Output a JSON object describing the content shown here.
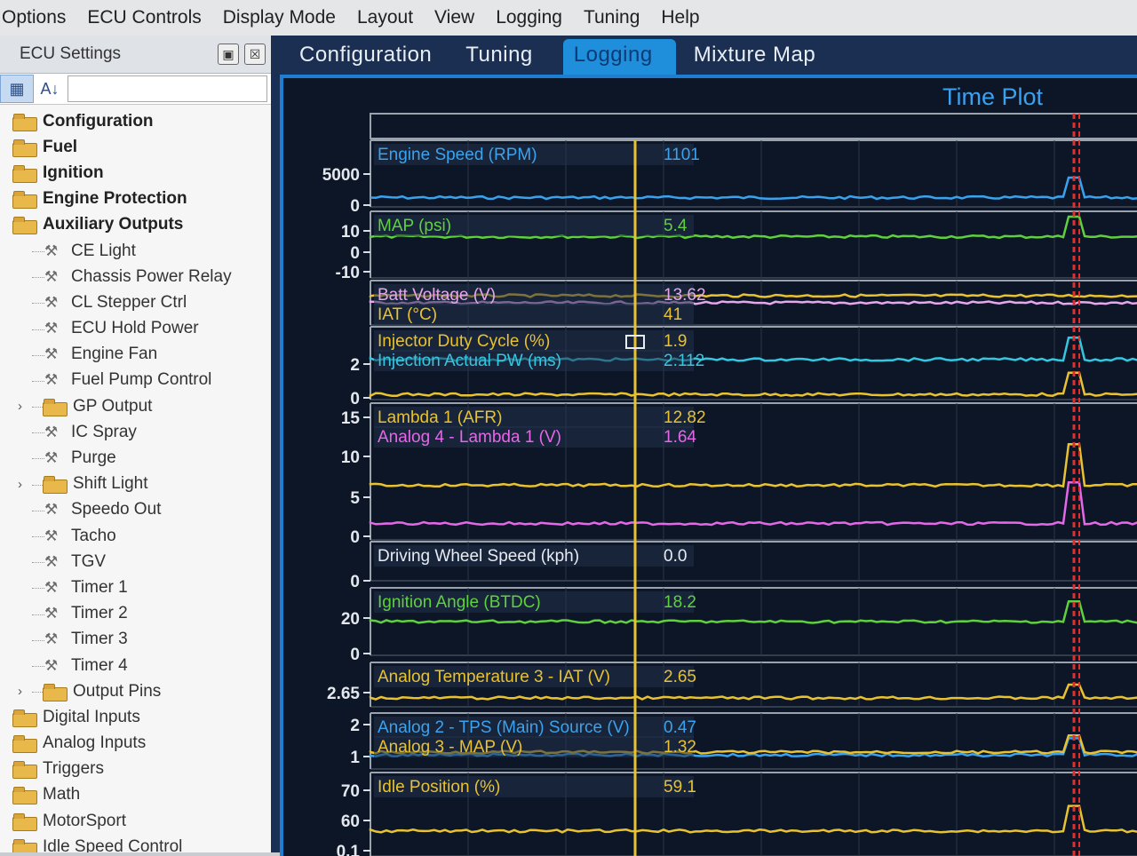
{
  "menu": [
    "Options",
    "ECU Controls",
    "Display Mode",
    "Layout",
    "View",
    "Logging",
    "Tuning",
    "Help"
  ],
  "sidebar": {
    "title": "ECU Settings",
    "pin_icon": "pin-icon",
    "close_icon": "close-icon",
    "items": [
      {
        "label": "Configuration",
        "type": "folder",
        "level": 0,
        "bold": true
      },
      {
        "label": "Fuel",
        "type": "folder",
        "level": 0,
        "bold": true
      },
      {
        "label": "Ignition",
        "type": "folder",
        "level": 0,
        "bold": true
      },
      {
        "label": "Engine Protection",
        "type": "folder",
        "level": 0,
        "bold": true
      },
      {
        "label": "Auxiliary Outputs",
        "type": "folder",
        "level": 0,
        "bold": true
      },
      {
        "label": "CE Light",
        "type": "setting",
        "level": 1
      },
      {
        "label": "Chassis Power Relay",
        "type": "setting",
        "level": 1
      },
      {
        "label": "CL Stepper Ctrl",
        "type": "setting",
        "level": 1
      },
      {
        "label": "ECU Hold Power",
        "type": "setting",
        "level": 1
      },
      {
        "label": "Engine Fan",
        "type": "setting",
        "level": 1
      },
      {
        "label": "Fuel Pump Control",
        "type": "setting",
        "level": 1
      },
      {
        "label": "GP Output",
        "type": "folder",
        "level": 1,
        "expander": true
      },
      {
        "label": "IC Spray",
        "type": "setting",
        "level": 1
      },
      {
        "label": "Purge",
        "type": "setting",
        "level": 1
      },
      {
        "label": "Shift Light",
        "type": "folder",
        "level": 1,
        "expander": true
      },
      {
        "label": "Speedo Out",
        "type": "setting",
        "level": 1
      },
      {
        "label": "Tacho",
        "type": "setting",
        "level": 1
      },
      {
        "label": "TGV",
        "type": "setting",
        "level": 1
      },
      {
        "label": "Timer 1",
        "type": "setting",
        "level": 1
      },
      {
        "label": "Timer 2",
        "type": "setting",
        "level": 1
      },
      {
        "label": "Timer 3",
        "type": "setting",
        "level": 1
      },
      {
        "label": "Timer 4",
        "type": "setting",
        "level": 1
      },
      {
        "label": "Output Pins",
        "type": "folder",
        "level": 1,
        "expander": true
      },
      {
        "label": "Digital Inputs",
        "type": "folder",
        "level": 0
      },
      {
        "label": "Analog Inputs",
        "type": "folder",
        "level": 0
      },
      {
        "label": "Triggers",
        "type": "folder",
        "level": 0
      },
      {
        "label": "Math",
        "type": "folder",
        "level": 0
      },
      {
        "label": "MotorSport",
        "type": "folder",
        "level": 0
      },
      {
        "label": "Idle Speed Control",
        "type": "folder",
        "level": 0
      }
    ]
  },
  "tabs": [
    {
      "label": "Configuration",
      "active": false
    },
    {
      "label": "Tuning",
      "active": false
    },
    {
      "label": "Logging",
      "active": true
    },
    {
      "label": "Mixture Map",
      "active": false
    }
  ],
  "plot": {
    "title": "Time Plot",
    "colors": {
      "background": "#0d1627",
      "cursor": "#e8c230",
      "marker": "#e0302e",
      "frame": "#9aa3ad"
    },
    "channels": [
      {
        "name": "Engine Speed (RPM)",
        "value": "1101",
        "color": "#3aa3ee",
        "ticks": [
          "5000",
          "0"
        ]
      },
      {
        "name": "MAP (psi)",
        "value": "5.4",
        "color": "#5fd13e",
        "ticks": [
          "10",
          "0",
          "-10"
        ]
      },
      {
        "name": "Batt Voltage (V)",
        "value": "13.62",
        "color": "#e6a7ec",
        "ticks": []
      },
      {
        "name": "IAT (°C)",
        "value": "41",
        "color": "#e8c230",
        "ticks": []
      },
      {
        "name": "Injector Duty Cycle (%)",
        "value": "1.9",
        "color": "#e8c230",
        "ticks": [
          "2",
          "0"
        ]
      },
      {
        "name": "Injection Actual PW (ms)",
        "value": "2.112",
        "color": "#35c7e0",
        "ticks": []
      },
      {
        "name": "Lambda 1 (AFR)",
        "value": "12.82",
        "color": "#e8c230",
        "ticks": [
          "15",
          "10",
          "5",
          "0"
        ]
      },
      {
        "name": "Analog 4 - Lambda 1 (V)",
        "value": "1.64",
        "color": "#e468e8",
        "ticks": []
      },
      {
        "name": "Driving Wheel Speed (kph)",
        "value": "0.0",
        "color": "#e8ecf2",
        "ticks": [
          "0"
        ]
      },
      {
        "name": "Ignition Angle (BTDC)",
        "value": "18.2",
        "color": "#5fd13e",
        "ticks": [
          "20",
          "0"
        ]
      },
      {
        "name": "Analog Temperature 3 - IAT (V)",
        "value": "2.65",
        "color": "#e8c230",
        "ticks": [
          "2.65"
        ]
      },
      {
        "name": "Analog 2 - TPS (Main) Source (V)",
        "value": "0.47",
        "color": "#3aa3ee",
        "ticks": [
          "2",
          "1"
        ]
      },
      {
        "name": "Analog 3 - MAP (V)",
        "value": "1.32",
        "color": "#e8c230",
        "ticks": []
      },
      {
        "name": "Idle Position (%)",
        "value": "59.1",
        "color": "#e8c230",
        "ticks": [
          "70",
          "60",
          "0.1"
        ]
      }
    ]
  }
}
